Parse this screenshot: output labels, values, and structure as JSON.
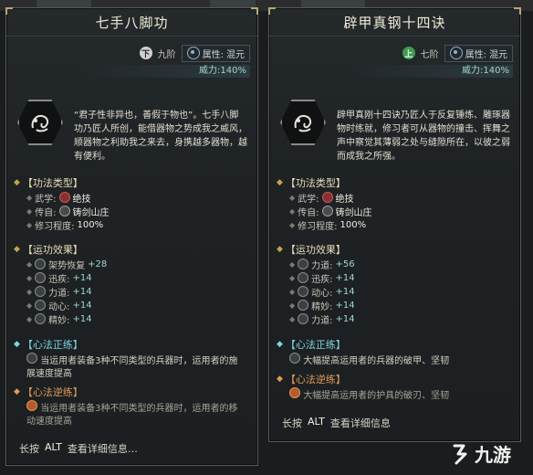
{
  "left": {
    "title": "七手八脚功",
    "rank_glyph": "下",
    "rank": "九阶",
    "attr_label": "属性:",
    "attr_value": "混元",
    "power": "威力:140%",
    "description": "“君子性非异也，善假于物也”。七手八脚功乃匠人所创，能借器物之势成我之威风，顺器物之利助我之来去，身携越多器物，越有便利。",
    "type_header": "【功法类型】",
    "type_rows": [
      {
        "label": "武学:",
        "value": "绝技",
        "icon": "fist-icon"
      },
      {
        "label": "传自:",
        "value": "铸剑山庄",
        "icon": "anchor-icon"
      },
      {
        "label": "修习程度:",
        "value": "100%",
        "icon": ""
      }
    ],
    "effect_header": "【运功效果】",
    "effects": [
      {
        "label": "架势恢复",
        "value": "+28"
      },
      {
        "label": "迅疾:",
        "value": "+14"
      },
      {
        "label": "力道:",
        "value": "+14"
      },
      {
        "label": "动心:",
        "value": "+14"
      },
      {
        "label": "精妙:",
        "value": "+14"
      }
    ],
    "forward_header": "【心法正练】",
    "forward_text": "当运用者装备3种不同类型的兵器时，运用者的施展速度提高",
    "reverse_header": "【心法逆练】",
    "reverse_text": "当运用者装备3种不同类型的兵器时，运用者的移动速度提高",
    "footer_hold": "长按",
    "footer_key": "ALT",
    "footer_detail": "查看详细信息…"
  },
  "right": {
    "title": "辟甲真钢十四诀",
    "rank_glyph": "上",
    "rank": "七阶",
    "attr_label": "属性:",
    "attr_value": "混元",
    "power": "威力:140%",
    "description": "辟甲真刚十四诀乃匠人于反复锤炼、雕琢器物时练就，修习者可从器物的撞击、挥舞之声中察觉其薄弱之处与缝隙所在，以彼之弱而成我之所强。",
    "type_header": "【功法类型】",
    "type_rows": [
      {
        "label": "武学:",
        "value": "绝技",
        "icon": "fist-icon"
      },
      {
        "label": "传自:",
        "value": "铸剑山庄",
        "icon": "anchor-icon"
      },
      {
        "label": "修习程度:",
        "value": "100%",
        "icon": ""
      }
    ],
    "effect_header": "【运功效果】",
    "effects": [
      {
        "label": "力道:",
        "value": "+56"
      },
      {
        "label": "迅疾:",
        "value": "+14"
      },
      {
        "label": "动心:",
        "value": "+14"
      },
      {
        "label": "精妙:",
        "value": "+14"
      },
      {
        "label": "力道:",
        "value": "+14"
      }
    ],
    "forward_header": "【心法正练】",
    "forward_text": "大幅提高运用者的兵器的破甲、坚韧",
    "reverse_header": "【心法逆练】",
    "reverse_text": "大幅提高运用者的护具的破刃、坚韧",
    "footer_hold": "长按",
    "footer_key": "ALT",
    "footer_detail": "查看详细信息"
  },
  "watermark": "九游",
  "colors": {
    "accent_gold": "#c9a34a",
    "cyan": "#7fd4e0",
    "orange": "#e09a5a",
    "stat_value": "#9fd6d0"
  }
}
